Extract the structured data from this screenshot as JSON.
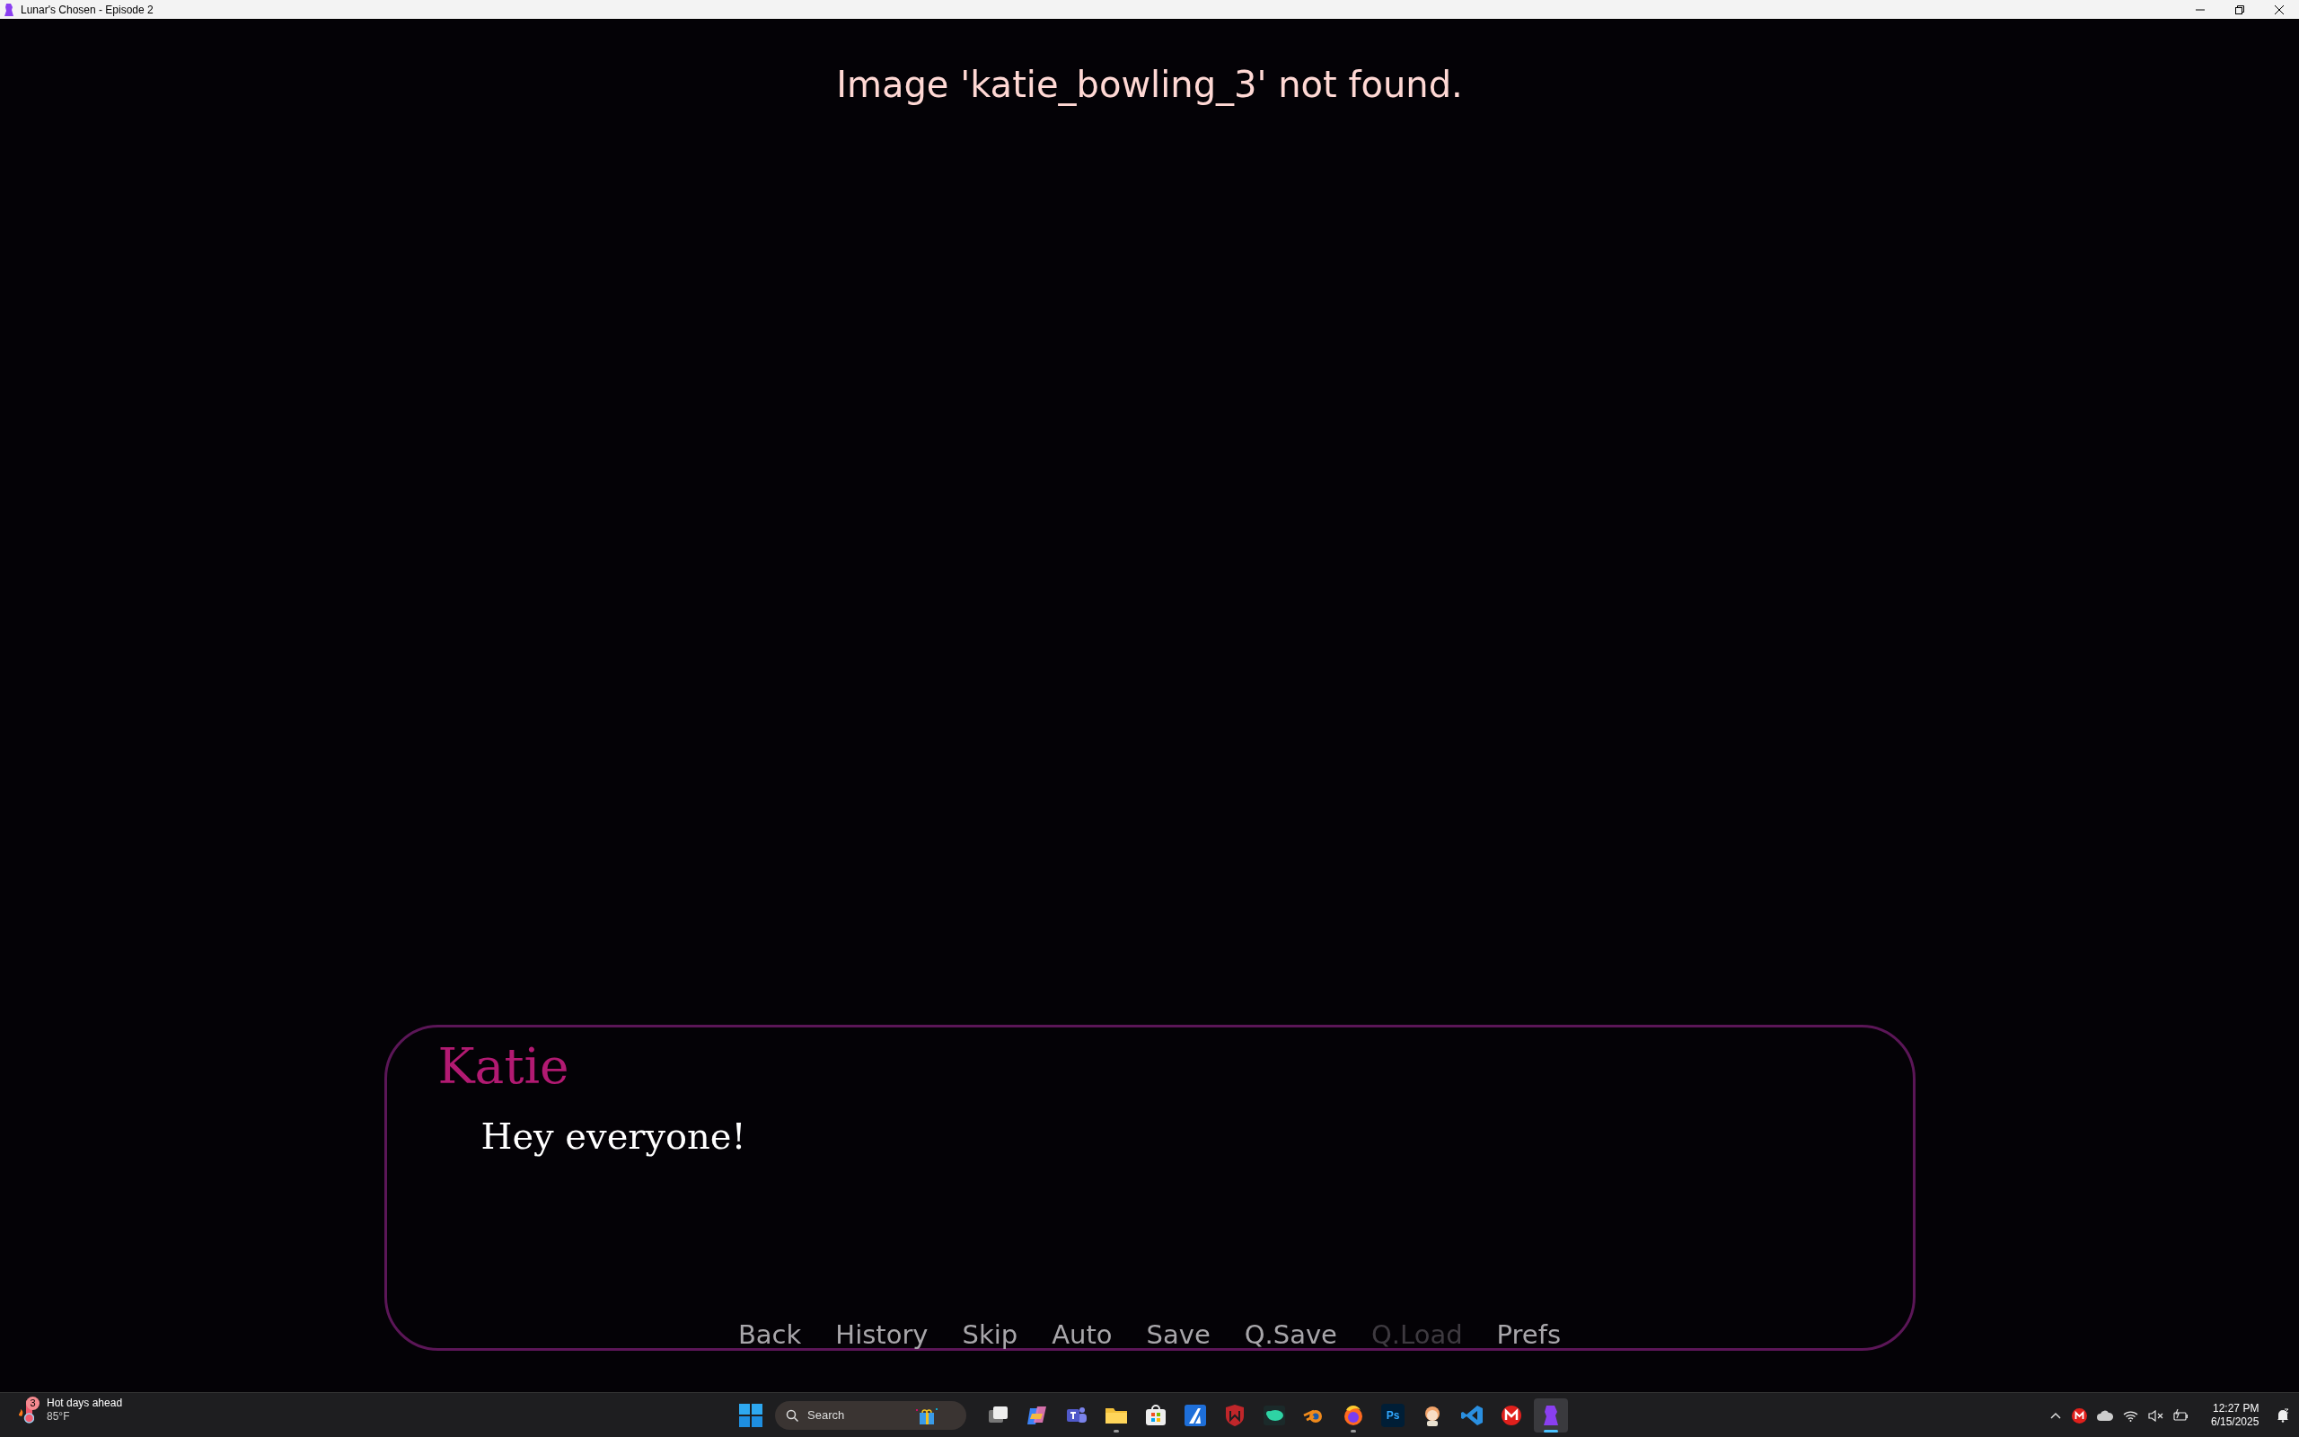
{
  "window": {
    "title": "Lunar's Chosen - Episode 2"
  },
  "game": {
    "error_text": "Image 'katie_bowling_3' not found.",
    "dialogue": {
      "speaker": "Katie",
      "text": "Hey everyone!"
    },
    "quick_menu": [
      {
        "label": "Back",
        "disabled": false
      },
      {
        "label": "History",
        "disabled": false
      },
      {
        "label": "Skip",
        "disabled": false
      },
      {
        "label": "Auto",
        "disabled": false
      },
      {
        "label": "Save",
        "disabled": false
      },
      {
        "label": "Q.Save",
        "disabled": false
      },
      {
        "label": "Q.Load",
        "disabled": true
      },
      {
        "label": "Prefs",
        "disabled": false
      }
    ]
  },
  "taskbar": {
    "weather": {
      "badge": "3",
      "title": "Hot days ahead",
      "temperature": "85°F"
    },
    "search": {
      "placeholder": "Search"
    },
    "apps": [
      {
        "kind": "taskview",
        "running": false,
        "active": false
      },
      {
        "kind": "copilot",
        "running": false,
        "active": false
      },
      {
        "kind": "teams",
        "running": false,
        "active": false
      },
      {
        "kind": "folder",
        "running": true,
        "active": false
      },
      {
        "kind": "store",
        "running": false,
        "active": false
      },
      {
        "kind": "blue-a",
        "running": false,
        "active": false
      },
      {
        "kind": "shield",
        "running": false,
        "active": false
      },
      {
        "kind": "green",
        "running": false,
        "active": false
      },
      {
        "kind": "blender",
        "running": false,
        "active": false
      },
      {
        "kind": "firefox",
        "running": true,
        "active": false
      },
      {
        "kind": "ps",
        "label": "Ps",
        "running": false,
        "active": false
      },
      {
        "kind": "character",
        "running": false,
        "active": false
      },
      {
        "kind": "vscode",
        "running": false,
        "active": false
      },
      {
        "kind": "mega",
        "running": false,
        "active": false
      },
      {
        "kind": "game",
        "running": true,
        "active": true
      }
    ],
    "clock": {
      "time": "12:27 PM",
      "date": "6/15/2025"
    }
  }
}
